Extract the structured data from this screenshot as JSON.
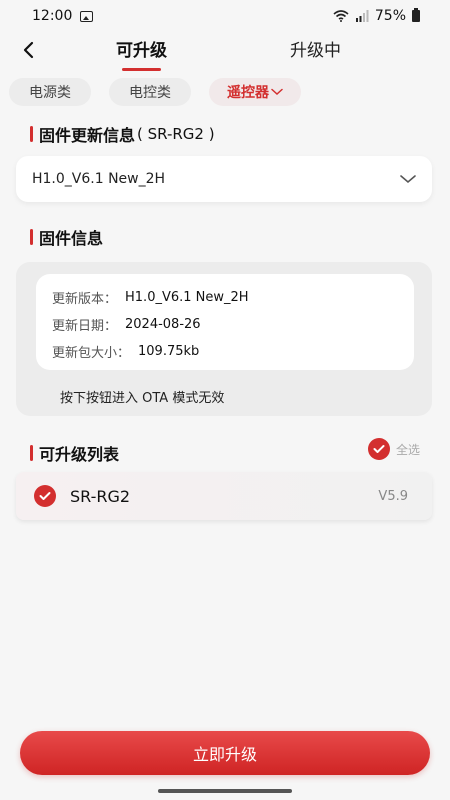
{
  "status_bar": {
    "time": "12:00",
    "battery": "75%"
  },
  "header": {
    "tabs": [
      {
        "label": "可升级"
      },
      {
        "label": "升级中"
      }
    ]
  },
  "categories": [
    {
      "label": "电源类"
    },
    {
      "label": "电控类"
    },
    {
      "label": "遥控器"
    }
  ],
  "firmware_update": {
    "title": "固件更新信息",
    "device": "( SR-RG2 )",
    "selected_version": "H1.0_V6.1 New_2H"
  },
  "firmware_info": {
    "title": "固件信息",
    "rows": [
      {
        "label": "更新版本：",
        "value": "H1.0_V6.1 New_2H"
      },
      {
        "label": "更新日期：",
        "value": "2024-08-26"
      },
      {
        "label": "更新包大小：",
        "value": "109.75kb"
      }
    ],
    "ota_note": "按下按钮进入 OTA 模式无效"
  },
  "upgradable_list": {
    "title": "可升级列表",
    "select_all": "全选",
    "items": [
      {
        "name": "SR-RG2",
        "version": "V5.9"
      }
    ]
  },
  "action": {
    "upgrade_label": "立即升级"
  },
  "colors": {
    "accent": "#d32f2f",
    "chip_bg": "#ececec"
  }
}
